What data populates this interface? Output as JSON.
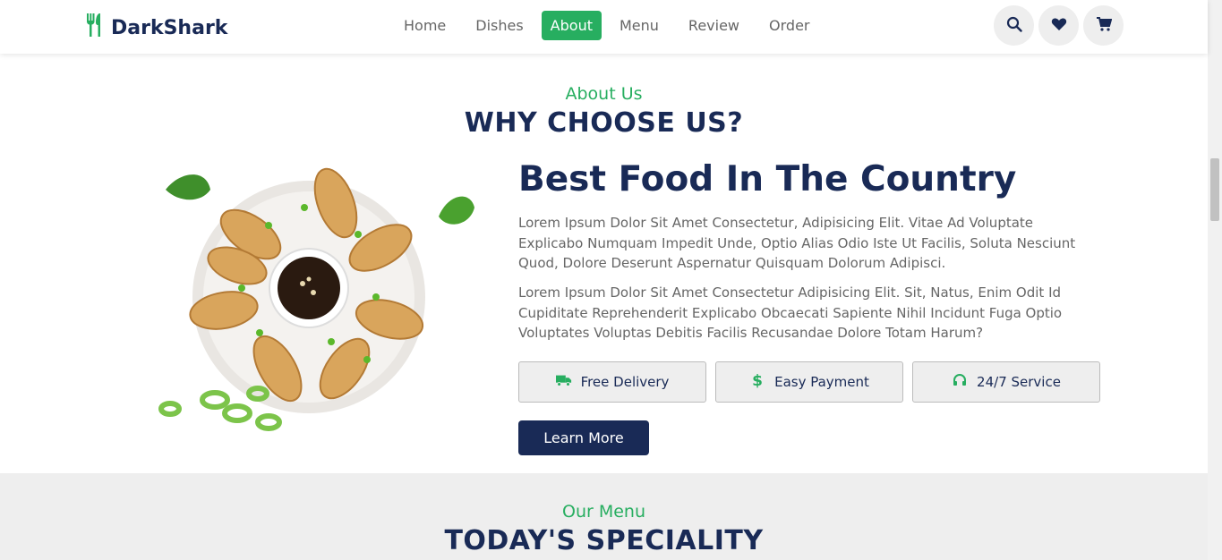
{
  "header": {
    "logo_text": "DarkShark",
    "logo_icon": "utensils-icon",
    "nav": [
      {
        "label": "Home",
        "active": false
      },
      {
        "label": "Dishes",
        "active": false
      },
      {
        "label": "About",
        "active": true
      },
      {
        "label": "Menu",
        "active": false
      },
      {
        "label": "Review",
        "active": false
      },
      {
        "label": "Order",
        "active": false
      }
    ],
    "icons": [
      "search-icon",
      "heart-icon",
      "cart-icon"
    ]
  },
  "about": {
    "sub_heading": "About Us",
    "heading": "WHY CHOOSE US?",
    "title": "Best Food In The Country",
    "paragraph1": "Lorem Ipsum Dolor Sit Amet Consectetur, Adipisicing Elit. Vitae Ad Voluptate Explicabo Numquam Impedit Unde, Optio Alias Odio Iste Ut Facilis, Soluta Nesciunt Quod, Dolore Deserunt Aspernatur Quisquam Dolorum Adipisci.",
    "paragraph2": "Lorem Ipsum Dolor Sit Amet Consectetur Adipisicing Elit. Sit, Natus, Enim Odit Id Cupiditate Reprehenderit Explicabo Obcaecati Sapiente Nihil Incidunt Fuga Optio Voluptates Voluptas Debitis Facilis Recusandae Dolore Totam Harum?",
    "features": [
      {
        "label": "Free Delivery",
        "icon": "truck-icon"
      },
      {
        "label": "Easy Payment",
        "icon": "dollar-icon"
      },
      {
        "label": "24/7 Service",
        "icon": "headset-icon"
      }
    ],
    "button_label": "Learn More"
  },
  "menu": {
    "sub_heading": "Our Menu",
    "heading": "TODAY'S SPECIALITY"
  },
  "colors": {
    "accent": "#27ae60",
    "navy": "#192a56",
    "text": "#666666",
    "light_bg": "#eeeeee"
  }
}
